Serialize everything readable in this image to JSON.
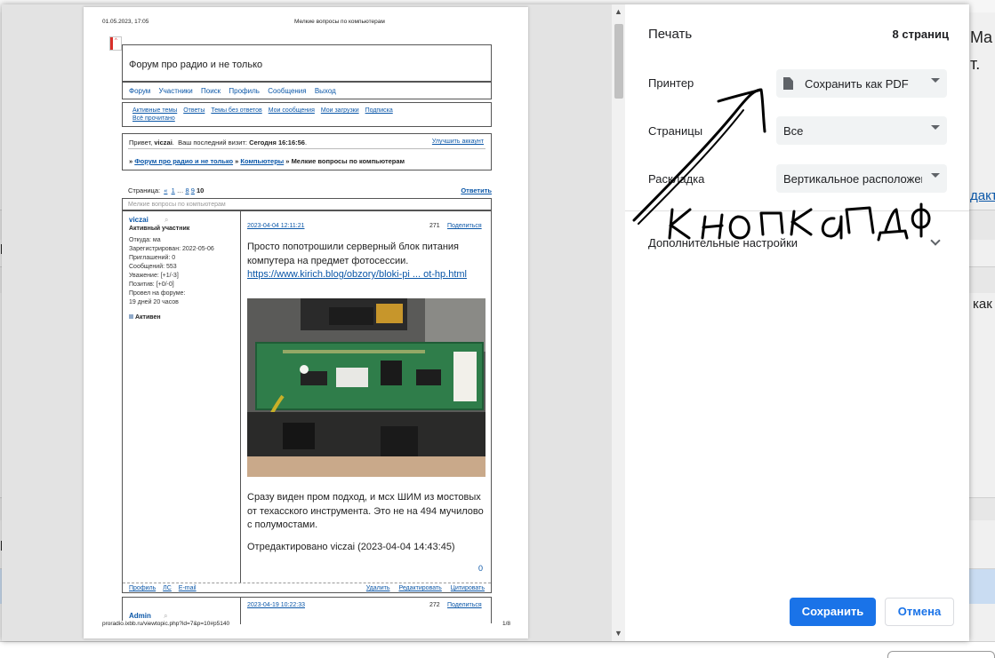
{
  "background": {
    "fragments": [
      "Ma",
      "т.",
      "дакт",
      "ь как",
      "р",
      "р"
    ]
  },
  "preview": {
    "header_date": "01.05.2023, 17:05",
    "header_title": "Мелкие вопросы по компьютерам",
    "footer_url": "proradio.ixbb.ru/viewtopic.php?id=7&p=10#p5140",
    "footer_page": "1/8",
    "forum_title": "Форум про радио и не только",
    "nav": [
      "Форум",
      "Участники",
      "Поиск",
      "Профиль",
      "Сообщения",
      "Выход"
    ],
    "quick_links": [
      "Активные темы",
      "Ответы",
      "Темы без ответов",
      "Мои сообщения",
      "Мои загрузки",
      "Подписка",
      "Всё прочитано"
    ],
    "greeting_prefix": "Привет,",
    "greeting_user": "viczai",
    "last_visit_label": "Ваш последний визит:",
    "last_visit_value": "Сегодня 16:16:56",
    "improve_account": "Улучшить аккаунт",
    "breadcrumb_lead": "»",
    "breadcrumb": [
      "Форум про радио и не только",
      "Компьютеры"
    ],
    "breadcrumb_current": "Мелкие вопросы по компьютерам",
    "pages_label": "Страница:",
    "pages": [
      "«",
      "1",
      "…",
      "8",
      "9",
      "10"
    ],
    "reply_link": "Ответить",
    "topic_header": "Мелкие вопросы по компьютерам",
    "post1": {
      "author": "viczai",
      "role": "Активный участник",
      "profile_lines": [
        "Откуда: ма",
        "Зарегистрирован: 2022-05-06",
        "Приглашений: 0",
        "Сообщений: 553",
        "Уважение: [+1/-3]",
        "Позитив: [+0/-0]",
        "Провел на форуме:",
        "19 дней 20 часов"
      ],
      "status": "Активен",
      "date": "2023-04-04 12:11:21",
      "number": "271",
      "share": "Поделиться",
      "text1": "Просто попотрошили серверный блок питания компутера на предмет фотосессии.",
      "link": "https://www.kirich.blog/obzory/bloki-pi ... ot-hp.html",
      "text2": "Сразу виден пром подход, и мсх ШИМ из мостовых от техасского инструмента. Это не на 494 мучилово с полумостами.",
      "edited": "Отредактировано viczai (2023-04-04 14:43:45)",
      "likes": "0",
      "footer_left": [
        "Профиль",
        "ЛС",
        "E-mail"
      ],
      "footer_right": [
        "Удалить",
        "Редактировать",
        "Цитировать"
      ]
    },
    "post2": {
      "author": "Admin",
      "date": "2023-04-19 10:22:33",
      "number": "272",
      "share": "Поделиться"
    }
  },
  "settings": {
    "title": "Печать",
    "pages_count": "8 страниц",
    "printer_label": "Принтер",
    "printer_value": "Сохранить как PDF",
    "pages_label": "Страницы",
    "pages_value": "Все",
    "layout_label": "Раскладка",
    "layout_value": "Вертикальное расположение",
    "more_settings": "Дополнительные настройки",
    "save_button": "Сохранить",
    "cancel_button": "Отмена"
  },
  "annotation": {
    "handwritten_text": "кнопка ПДФ"
  },
  "colors": {
    "accent": "#1a73e8",
    "annotation": "#000000",
    "preview_bg": "#e3e3e3",
    "select_bg": "#f1f3f4"
  }
}
